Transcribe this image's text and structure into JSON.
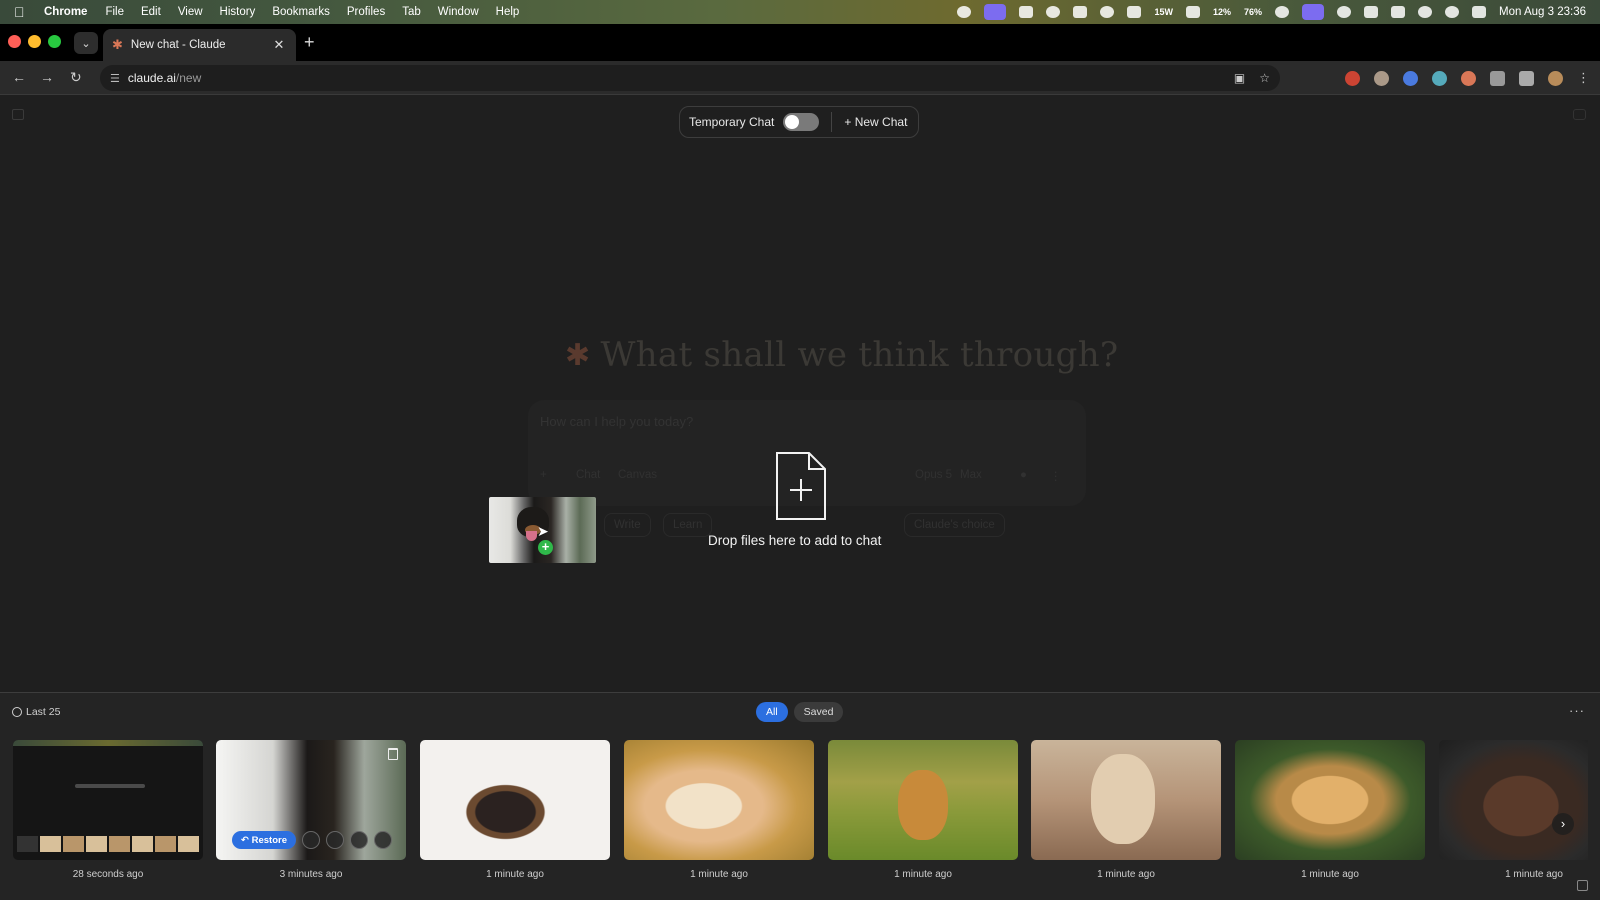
{
  "menubar": {
    "app_name": "Chrome",
    "menus": [
      "File",
      "Edit",
      "View",
      "History",
      "Bookmarks",
      "Profiles",
      "Tab",
      "Window",
      "Help"
    ],
    "status_readouts": {
      "power": "15W",
      "cpu": "12%",
      "ram": "76%"
    },
    "clock": "Mon Aug 3  23:36"
  },
  "tab": {
    "title": "New chat - Claude"
  },
  "omnibox": {
    "host": "claude.ai",
    "path": "/new"
  },
  "top_controls": {
    "temporary_chat_label": "Temporary Chat",
    "temporary_chat_on": false,
    "new_chat_label": "+ New Chat"
  },
  "greeting": "What shall we think through?",
  "composer": {
    "placeholder": "How can I help you today?",
    "mode_chat": "Chat",
    "mode_canvas": "Canvas",
    "model": "Opus 5",
    "effort": "Max",
    "suggestions": [
      "Write",
      "Learn",
      "Claude's choice"
    ]
  },
  "drop_overlay": {
    "message": "Drop files here to add to chat"
  },
  "clip_panel": {
    "history_label": "Last 25",
    "filters": [
      "All",
      "Saved"
    ],
    "active_filter": "All",
    "restore_label": "Restore",
    "items": [
      {
        "time": "28 seconds ago",
        "subject": "screenshot"
      },
      {
        "time": "3 minutes ago",
        "subject": "rottweiler"
      },
      {
        "time": "1 minute ago",
        "subject": "chihuahua"
      },
      {
        "time": "1 minute ago",
        "subject": "pomeranian"
      },
      {
        "time": "1 minute ago",
        "subject": "golden retriever"
      },
      {
        "time": "1 minute ago",
        "subject": "poodle"
      },
      {
        "time": "1 minute ago",
        "subject": "yorkshire terrier"
      },
      {
        "time": "1 minute ago",
        "subject": "pit bull"
      }
    ]
  },
  "colors": {
    "accent": "#2c6fe0",
    "claude_orange": "#d97757",
    "background": "#1f1f1f"
  }
}
